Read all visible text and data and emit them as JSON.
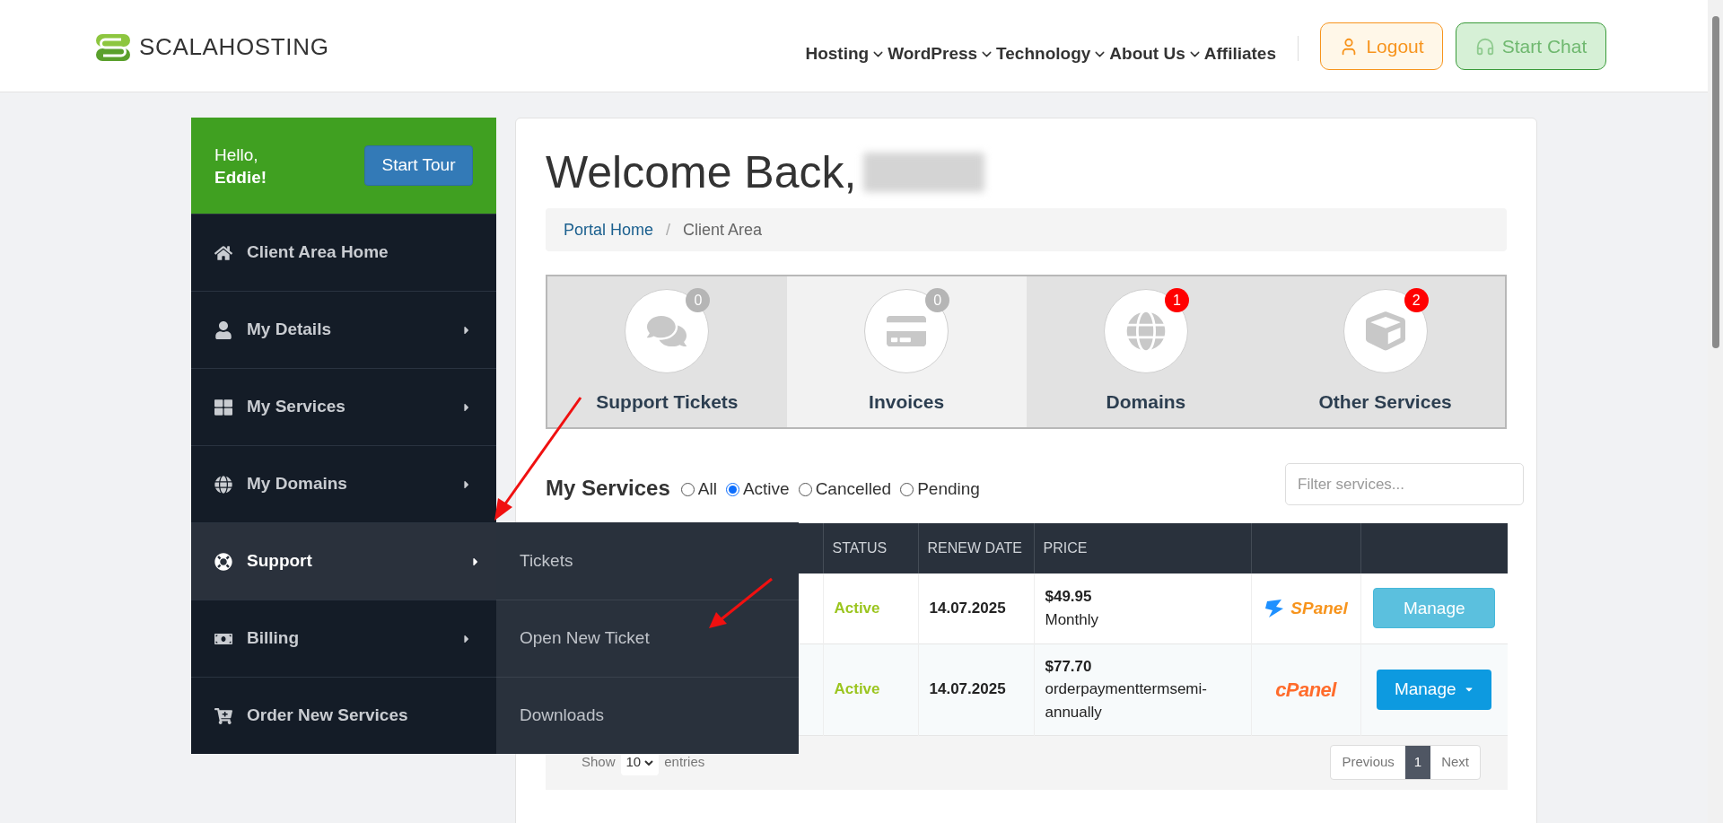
{
  "header": {
    "logo": "SCALAHOSTING",
    "nav": [
      {
        "label": "Hosting",
        "dropdown": true
      },
      {
        "label": "WordPress",
        "dropdown": true
      },
      {
        "label": "Technology",
        "dropdown": true
      },
      {
        "label": "About Us",
        "dropdown": true
      },
      {
        "label": "Affiliates",
        "dropdown": false
      }
    ],
    "logout": "Logout",
    "start_chat": "Start Chat"
  },
  "sidebar": {
    "greeting": "Hello,",
    "name": "Eddie!",
    "tour_button": "Start Tour",
    "items": [
      {
        "label": "Client Area Home",
        "kind": "home",
        "submenu": false,
        "selected": false
      },
      {
        "label": "My Details",
        "kind": "user",
        "submenu": true,
        "selected": false
      },
      {
        "label": "My Services",
        "kind": "grid",
        "submenu": true,
        "selected": false
      },
      {
        "label": "My Domains",
        "kind": "globe",
        "submenu": true,
        "selected": false
      },
      {
        "label": "Support",
        "kind": "lifering",
        "submenu": true,
        "selected": true,
        "children": [
          {
            "label": "Tickets"
          },
          {
            "label": "Open New Ticket"
          },
          {
            "label": "Downloads"
          }
        ]
      },
      {
        "label": "Billing",
        "kind": "money",
        "submenu": true,
        "selected": false
      },
      {
        "label": "Order New Services",
        "kind": "cart",
        "submenu": false,
        "selected": false
      }
    ]
  },
  "main": {
    "title": "Welcome Back,",
    "breadcrumb": [
      {
        "label": "Portal Home",
        "link": true
      },
      {
        "label": "Client Area",
        "link": false
      }
    ],
    "breadcrumb_separator": "/",
    "tiles": [
      {
        "label": "Support Tickets",
        "kind": "comments",
        "count": "0",
        "color": "#b5b5b5",
        "highlighted": false
      },
      {
        "label": "Invoices",
        "kind": "card",
        "count": "0",
        "color": "#b5b5b5",
        "highlighted": true
      },
      {
        "label": "Domains",
        "kind": "globe",
        "count": "1",
        "color": "#ff0000",
        "highlighted": false
      },
      {
        "label": "Other Services",
        "kind": "cube",
        "count": "2",
        "color": "#ff0000",
        "highlighted": false
      }
    ],
    "services": {
      "title": "My Services",
      "filters": [
        {
          "label": "All",
          "selected": false
        },
        {
          "label": "Active",
          "selected": true
        },
        {
          "label": "Cancelled",
          "selected": false
        },
        {
          "label": "Pending",
          "selected": false
        }
      ],
      "search": {
        "placeholder": "Filter services..."
      },
      "columns": [
        "STATUS",
        "RENEW DATE",
        "PRICE"
      ],
      "rows": [
        {
          "status": "Active",
          "renew_date": "14.07.2025",
          "price": "$49.95",
          "term": "Monthly",
          "panel": {
            "kind": "spanel",
            "label": "SPanel"
          },
          "button": {
            "label": "Manage",
            "kind": "plain"
          }
        },
        {
          "status": "Active",
          "renew_date": "14.07.2025",
          "price": "$77.70",
          "term": "orderpaymenttermsemi-annually",
          "panel": {
            "kind": "cpanel",
            "label": "cPanel"
          },
          "button": {
            "label": "Manage",
            "kind": "dropdown"
          }
        }
      ],
      "footer": {
        "show": "Show",
        "page_size": "10",
        "entries": "entries",
        "previous": "Previous",
        "pages": [
          {
            "label": "1",
            "selected": true
          }
        ],
        "next": "Next"
      }
    }
  }
}
